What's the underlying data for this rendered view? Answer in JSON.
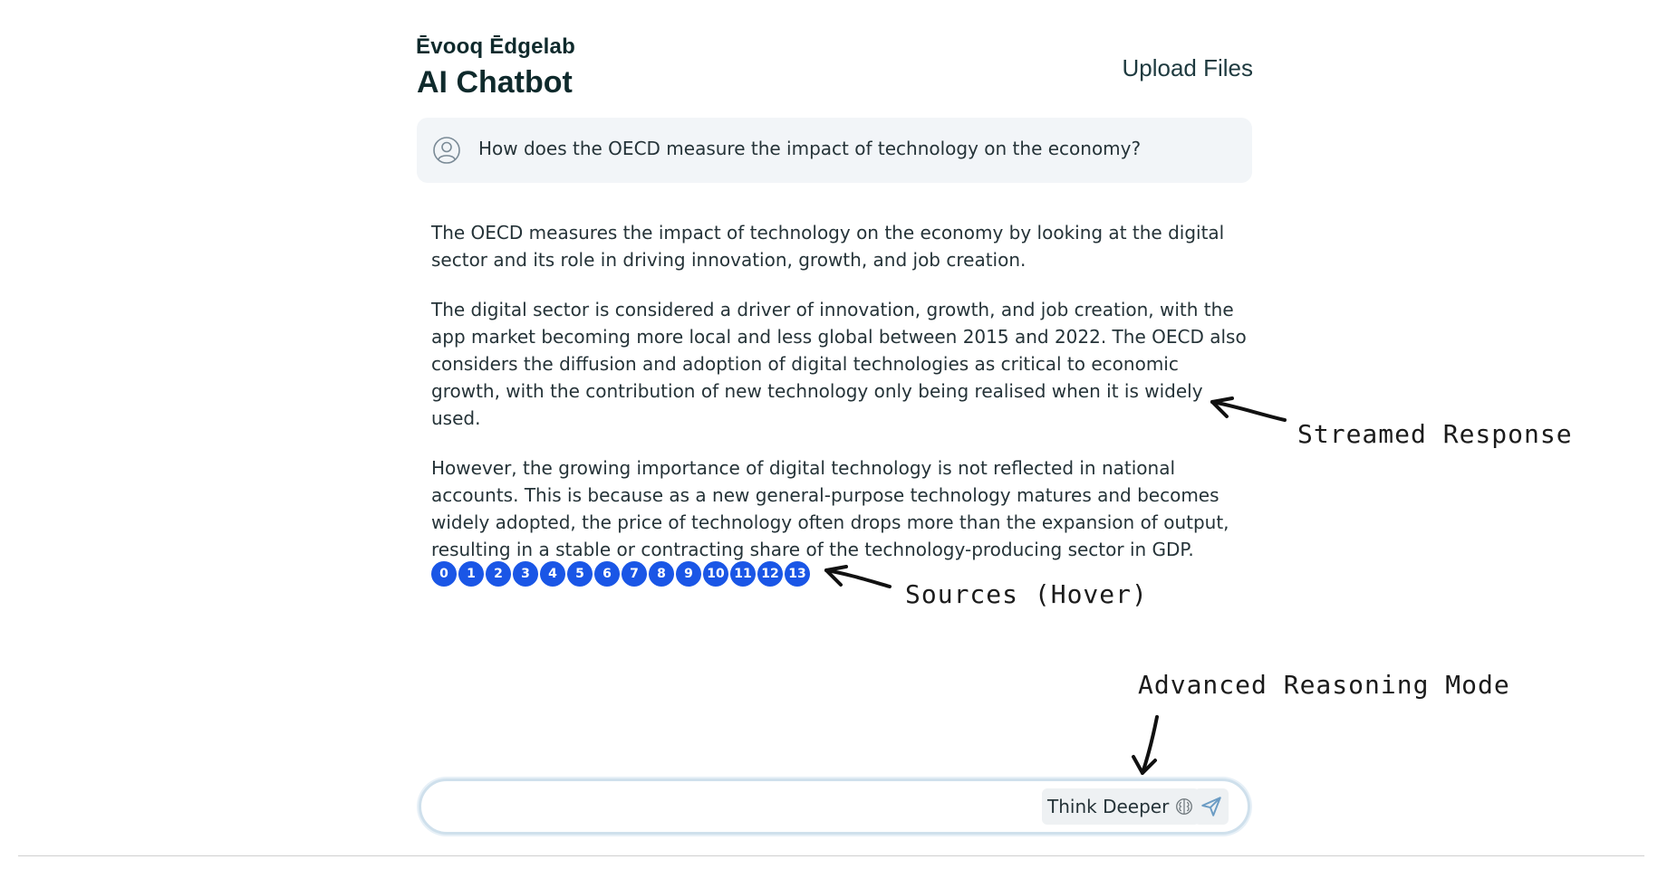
{
  "header": {
    "brand": "Ēvooq Ēdgelab",
    "title": "AI Chatbot",
    "upload_label": "Upload Files"
  },
  "conversation": {
    "question": "How does the OECD measure the impact of technology on the economy?",
    "answer_paragraphs": [
      "The OECD measures the impact of technology on the economy by looking at the digital sector and its role in driving innovation, growth, and job creation.",
      "The digital sector is considered a driver of innovation, growth, and job creation, with the app market becoming more local and less global between 2015 and 2022. The OECD also considers the diffusion and adoption of digital technologies as critical to economic growth, with the contribution of new technology only being realised when it is widely used.",
      "However, the growing importance of digital technology is not reflected in national accounts. This is because as a new general-purpose technology matures and becomes widely adopted, the price of technology often drops more than the expansion of output, resulting in a stable or contracting share of the technology-producing sector in GDP."
    ],
    "sources": [
      "0",
      "1",
      "2",
      "3",
      "4",
      "5",
      "6",
      "7",
      "8",
      "9",
      "10",
      "11",
      "12",
      "13"
    ]
  },
  "annotations": {
    "streamed": "Streamed Response",
    "sources": "Sources (Hover)",
    "advanced": "Advanced Reasoning Mode"
  },
  "input": {
    "value": "",
    "placeholder": "",
    "think_label": "Think Deeper"
  },
  "colors": {
    "source_badge": "#1a56e6",
    "question_bg": "#f2f5f8",
    "input_border": "#cfe0ec"
  },
  "icons": {
    "user": "user-circle-icon",
    "brain": "brain-icon",
    "send": "send-icon"
  }
}
